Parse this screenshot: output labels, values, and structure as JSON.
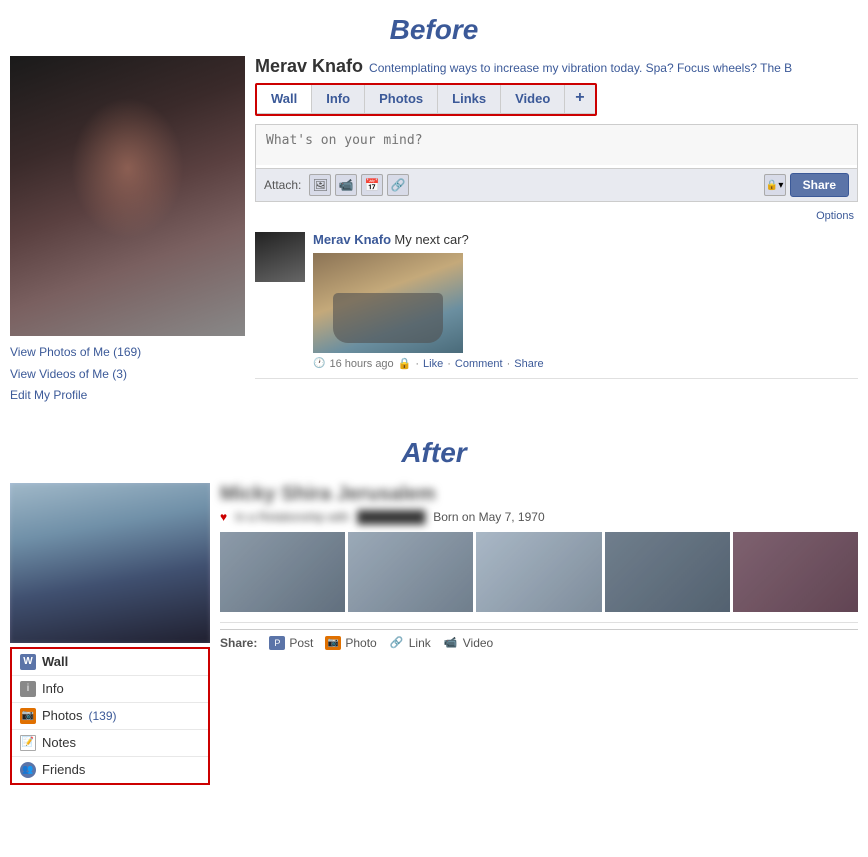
{
  "before": {
    "title": "Before",
    "profile": {
      "name": "Merav Knafo",
      "status": "Contemplating ways to increase my vibration today. Spa? Focus wheels? The B",
      "tabs": [
        "Wall",
        "Info",
        "Photos",
        "Links",
        "Video",
        "+"
      ],
      "active_tab": "Wall"
    },
    "wall_input_placeholder": "What's on your mind?",
    "attach_label": "Attach:",
    "share_button": "Share",
    "options_label": "Options",
    "photo_links": {
      "photos": "View Photos of Me (169)",
      "videos": "View Videos of Me (3)",
      "edit": "Edit My Profile"
    },
    "post": {
      "author": "Merav Knafo",
      "text": "My next car?",
      "time": "16 hours ago",
      "actions": [
        "Like",
        "Comment",
        "Share"
      ]
    }
  },
  "after": {
    "title": "After",
    "profile": {
      "name": "Micky Shira Jerusalem",
      "relationship": "In a Relationship with",
      "born": "Born on May 7, 1970"
    },
    "nav": {
      "items": [
        {
          "id": "wall",
          "label": "Wall",
          "icon": "wall",
          "active": true
        },
        {
          "id": "info",
          "label": "Info",
          "icon": "info",
          "active": false
        },
        {
          "id": "photos",
          "label": "Photos",
          "icon": "photos",
          "count": "(139)",
          "active": false
        },
        {
          "id": "notes",
          "label": "Notes",
          "icon": "notes",
          "active": false
        },
        {
          "id": "friends",
          "label": "Friends",
          "icon": "friends",
          "active": false
        }
      ]
    },
    "share": {
      "label": "Share:",
      "options": [
        "Post",
        "Photo",
        "Link",
        "Video"
      ]
    }
  }
}
